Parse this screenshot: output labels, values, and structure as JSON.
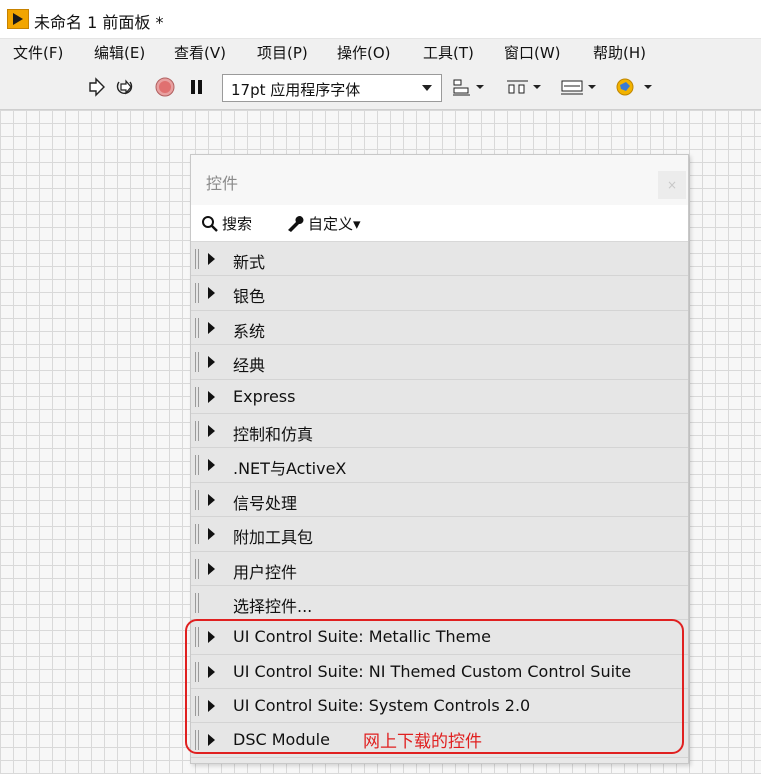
{
  "window": {
    "title": "未命名 1 前面板 *"
  },
  "menu": [
    "文件(F)",
    "编辑(E)",
    "查看(V)",
    "项目(P)",
    "操作(O)",
    "工具(T)",
    "窗口(W)",
    "帮助(H)"
  ],
  "toolbar": {
    "font_select": "17pt 应用程序字体",
    "icons": [
      "run-arrow-icon",
      "run-continuous-icon",
      "abort-icon",
      "pause-icon",
      "align-icon",
      "distribute-icon",
      "resize-icon",
      "reorder-icon"
    ]
  },
  "palette": {
    "title": "控件",
    "close": "×",
    "search": "搜索",
    "customize": "自定义▾",
    "items": [
      {
        "label": "新式",
        "expandable": true
      },
      {
        "label": "银色",
        "expandable": true
      },
      {
        "label": "系统",
        "expandable": true
      },
      {
        "label": "经典",
        "expandable": true
      },
      {
        "label": "Express",
        "expandable": true
      },
      {
        "label": "控制和仿真",
        "expandable": true
      },
      {
        "label": ".NET与ActiveX",
        "expandable": true
      },
      {
        "label": "信号处理",
        "expandable": true
      },
      {
        "label": "附加工具包",
        "expandable": true
      },
      {
        "label": "用户控件",
        "expandable": true
      },
      {
        "label": "选择控件...",
        "expandable": false
      },
      {
        "label": "UI Control Suite: Metallic Theme",
        "expandable": true
      },
      {
        "label": "UI Control Suite: NI Themed Custom Control Suite",
        "expandable": true
      },
      {
        "label": "UI Control Suite: System Controls 2.0",
        "expandable": true
      },
      {
        "label": "DSC Module",
        "expandable": true
      }
    ]
  },
  "annotation": {
    "text": "网上下载的控件",
    "color": "#e02020"
  }
}
